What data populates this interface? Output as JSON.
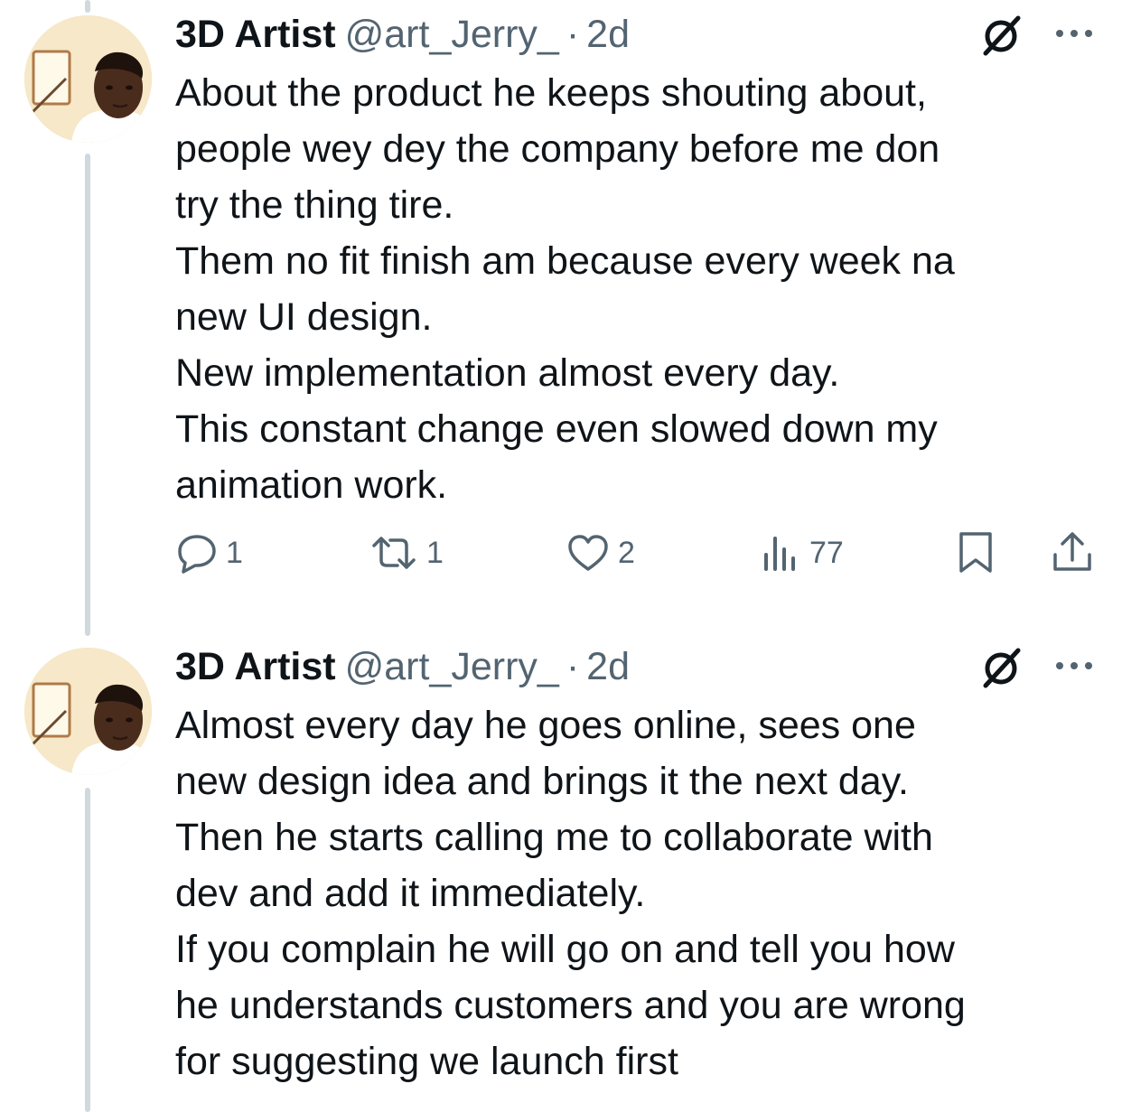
{
  "tweets": [
    {
      "author_name": "3D Artist",
      "handle": "@art_Jerry_",
      "separator": "·",
      "time": "2d",
      "text": "About the product he keeps shouting about,\npeople wey dey the company before me don\ntry the thing tire.\nThem no fit finish am because every week na\nnew UI design.\nNew implementation almost every day.\nThis constant change even slowed down my\nanimation work.",
      "replies": "1",
      "reposts": "1",
      "likes": "2",
      "views": "77"
    },
    {
      "author_name": "3D Artist",
      "handle": "@art_Jerry_",
      "separator": "·",
      "time": "2d",
      "text": "Almost every day he goes online, sees one\nnew design idea and brings it the next day.\nThen he starts calling me to collaborate with\ndev and add it immediately.\nIf you complain he will go on and tell you how\nhe understands customers and you are wrong\nfor suggesting we launch first"
    }
  ],
  "icons": {
    "grok": "grok-icon",
    "more": "more-icon",
    "reply": "reply-icon",
    "repost": "repost-icon",
    "like": "heart-icon",
    "views": "views-icon",
    "bookmark": "bookmark-icon",
    "share": "share-icon"
  },
  "colors": {
    "text": "#0f1419",
    "secondary": "#536471",
    "thread_line": "#cfd9de",
    "background": "#ffffff"
  }
}
